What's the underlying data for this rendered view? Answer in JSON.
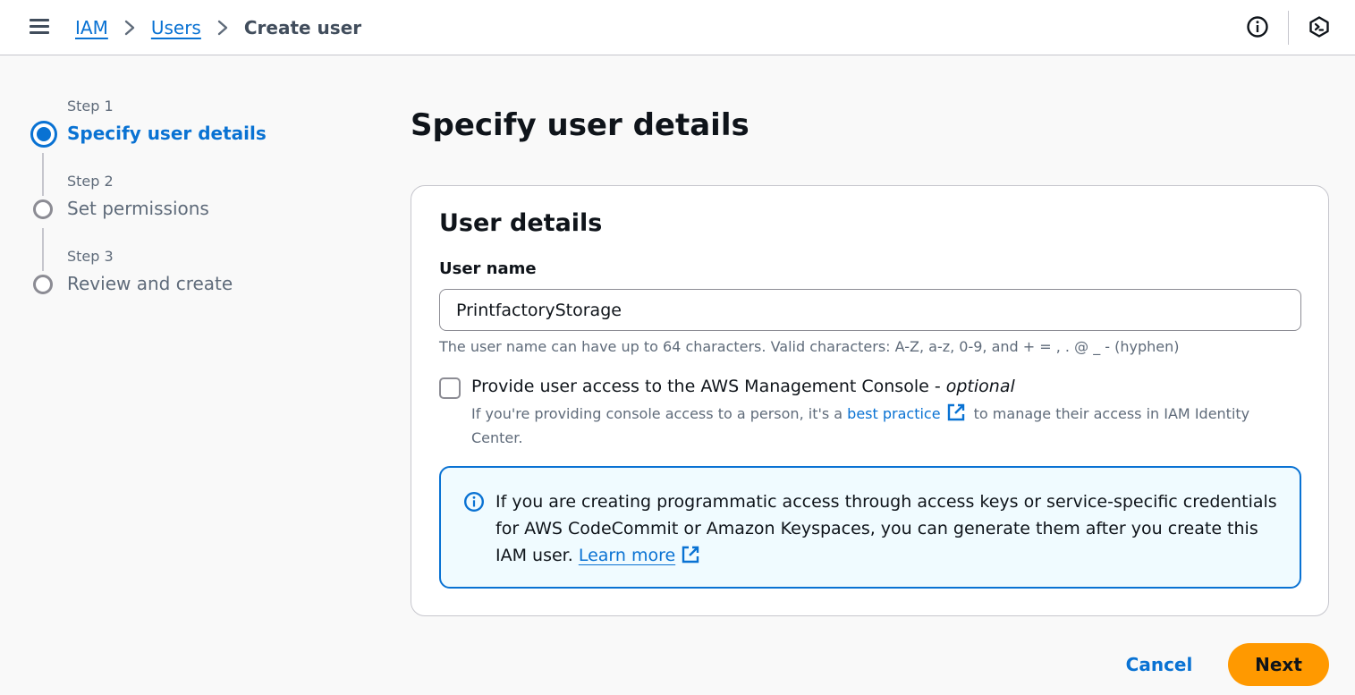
{
  "header": {
    "breadcrumbs": [
      {
        "label": "IAM"
      },
      {
        "label": "Users"
      },
      {
        "label": "Create user"
      }
    ],
    "icons": [
      "menu-icon",
      "info-icon",
      "cloudshell-icon"
    ]
  },
  "wizard": {
    "steps": [
      {
        "number": "Step 1",
        "title": "Specify user details",
        "state": "active"
      },
      {
        "number": "Step 2",
        "title": "Set permissions",
        "state": "inactive"
      },
      {
        "number": "Step 3",
        "title": "Review and create",
        "state": "inactive"
      }
    ]
  },
  "main": {
    "page_title": "Specify user details",
    "card": {
      "title": "User details",
      "user_name": {
        "label": "User name",
        "value": "PrintfactoryStorage",
        "hint": "The user name can have up to 64 characters. Valid characters: A-Z, a-z, 0-9, and + = , . @ _ - (hyphen)"
      },
      "console_access": {
        "checked": false,
        "label": "Provide user access to the AWS Management Console - ",
        "label_optional": "optional",
        "desc_before": "If you're providing console access to a person, it's a ",
        "desc_link": "best practice",
        "desc_after": " to manage their access in IAM Identity Center."
      },
      "alert": {
        "text": "If you are creating programmatic access through access keys or service-specific credentials for AWS CodeCommit or Amazon Keyspaces, you can generate them after you create this IAM user. ",
        "link": "Learn more"
      }
    }
  },
  "footer": {
    "cancel_label": "Cancel",
    "next_label": "Next"
  },
  "colors": {
    "accent": "#0972d3",
    "primary_button": "#ff9900",
    "alert_background": "#f0fbff"
  }
}
